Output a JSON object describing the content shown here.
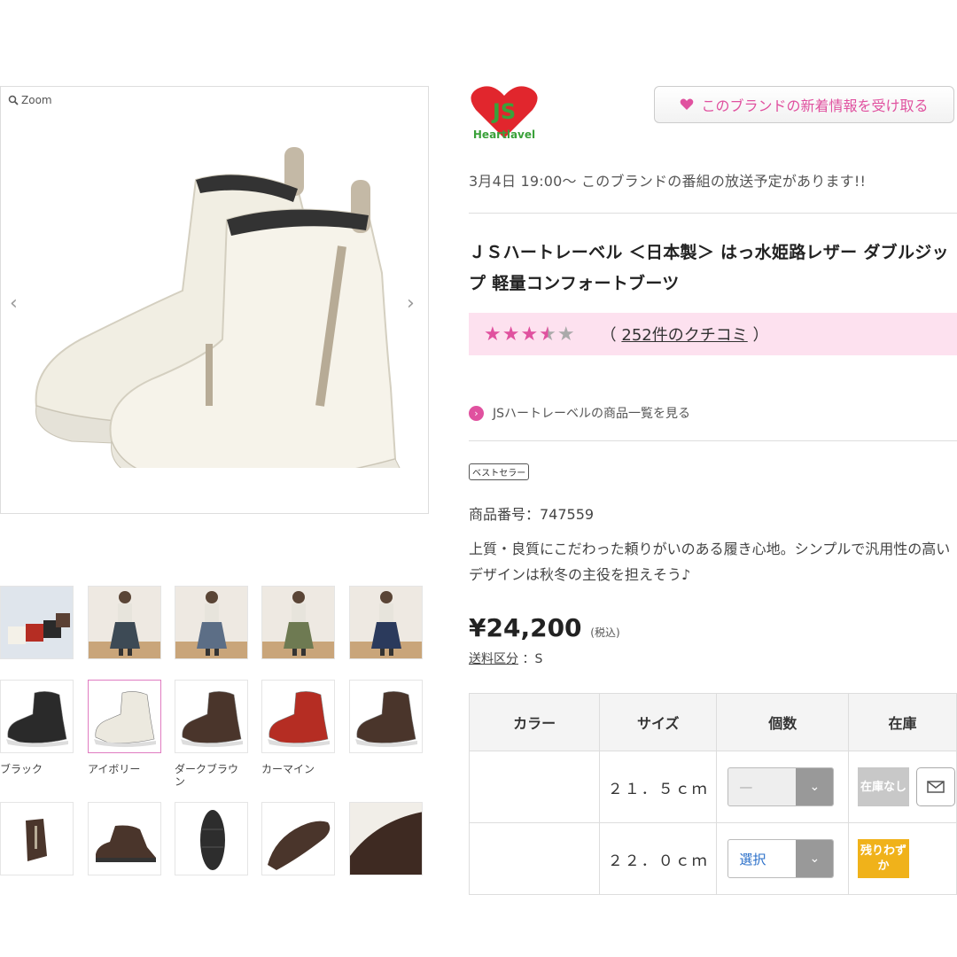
{
  "gallery": {
    "zoom_label": "Zoom",
    "prev_icon": "chevron-left-icon",
    "next_icon": "chevron-right-icon",
    "swatches": [
      {
        "label": "ブラック",
        "color": "#2a2a2a"
      },
      {
        "label": "アイボリー",
        "color": "#ece9df"
      },
      {
        "label": "ダークブラウン",
        "color": "#4a352b"
      },
      {
        "label": "カーマイン",
        "color": "#b52d23"
      },
      {
        "label": "",
        "color": "#4a352b"
      }
    ]
  },
  "brand": {
    "logo_text": "JS",
    "logo_subtext": "Heartlavel",
    "follow_label": "このブランドの新着情報を受け取る",
    "broadcast": "3月4日 19:00〜  このブランドの番組の放送予定があります!!",
    "link_label": "JSハートレーベルの商品一覧を見る"
  },
  "product": {
    "title": "ＪＳハートレーベル ＜日本製＞ はっ水姫路レザー ダブルジップ 軽量コンフォートブーツ",
    "rating": 4.5,
    "reviews_open": "（",
    "reviews_label": "252件のクチコミ",
    "reviews_close": "）",
    "badge": "ベストセラー",
    "code": "商品番号：747559",
    "description": "上質・良質にこだわった頼りがいのある履き心地。シンプルで汎用性の高いデザインは秋冬の主役を担えそう♪",
    "price": "¥24,200",
    "tax": "(税込)",
    "shipping_label": "送料区分",
    "shipping_value": "：S"
  },
  "table": {
    "headers": [
      "カラー",
      "サイズ",
      "個数",
      "在庫"
    ],
    "rows": [
      {
        "size": "２１．５ｃｍ",
        "qty": "—",
        "qty_enabled": false,
        "stock": "在庫なし",
        "stock_color": "#c8c8c8",
        "show_mail": true
      },
      {
        "size": "２２．０ｃｍ",
        "qty": "選択",
        "qty_enabled": true,
        "stock": "残りわずか",
        "stock_color": "#f0b21a",
        "show_mail": false
      }
    ]
  },
  "colors": {
    "accent": "#e0519f",
    "rating_bg": "#fde1ef",
    "link_blue": "#2a6fc9"
  }
}
